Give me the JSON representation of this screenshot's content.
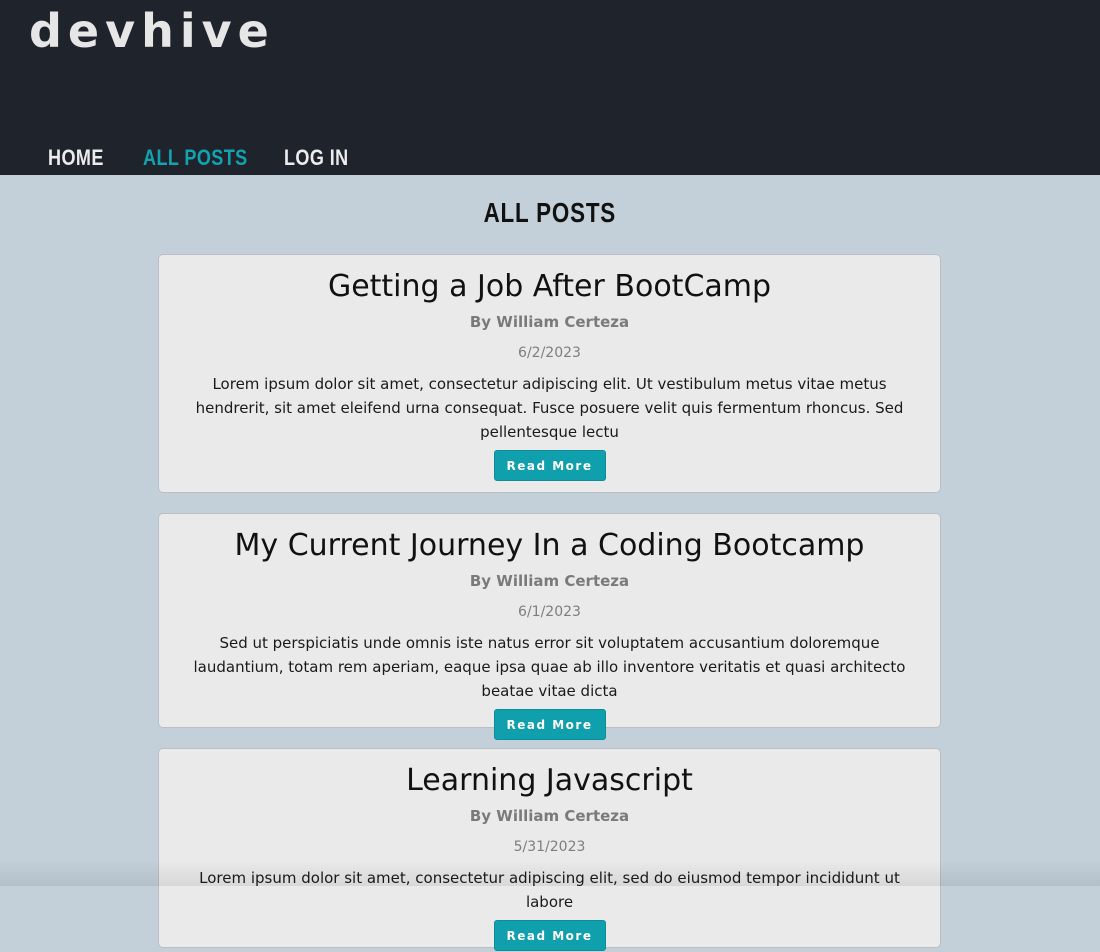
{
  "header": {
    "logo": "devhive",
    "nav": [
      {
        "label": "HOME",
        "active": false
      },
      {
        "label": "ALL POSTS",
        "active": true
      },
      {
        "label": "LOG IN",
        "active": false
      }
    ]
  },
  "main": {
    "heading": "ALL POSTS",
    "posts": [
      {
        "title": "Getting a Job After BootCamp",
        "author": "By William Certeza",
        "date": "6/2/2023",
        "excerpt": "Lorem ipsum dolor sit amet, consectetur adipiscing elit. Ut vestibulum metus vitae metus hendrerit, sit amet eleifend urna consequat. Fusce posuere velit quis fermentum rhoncus. Sed pellentesque lectu",
        "button": "Read More"
      },
      {
        "title": "My Current Journey In a Coding Bootcamp",
        "author": "By William Certeza",
        "date": "6/1/2023",
        "excerpt": "Sed ut perspiciatis unde omnis iste natus error sit voluptatem accusantium doloremque laudantium, totam rem aperiam, eaque ipsa quae ab illo inventore veritatis et quasi architecto beatae vitae dicta",
        "button": "Read More"
      },
      {
        "title": "Learning Javascript",
        "author": "By William Certeza",
        "date": "5/31/2023",
        "excerpt": "Lorem ipsum dolor sit amet, consectetur adipiscing elit, sed do eiusmod tempor incididunt ut labore",
        "button": "Read More"
      }
    ]
  },
  "colors": {
    "header_bg": "#1f232c",
    "page_bg": "#c3d0d9",
    "accent": "#11a3b0",
    "card_bg": "#eaeaea"
  }
}
